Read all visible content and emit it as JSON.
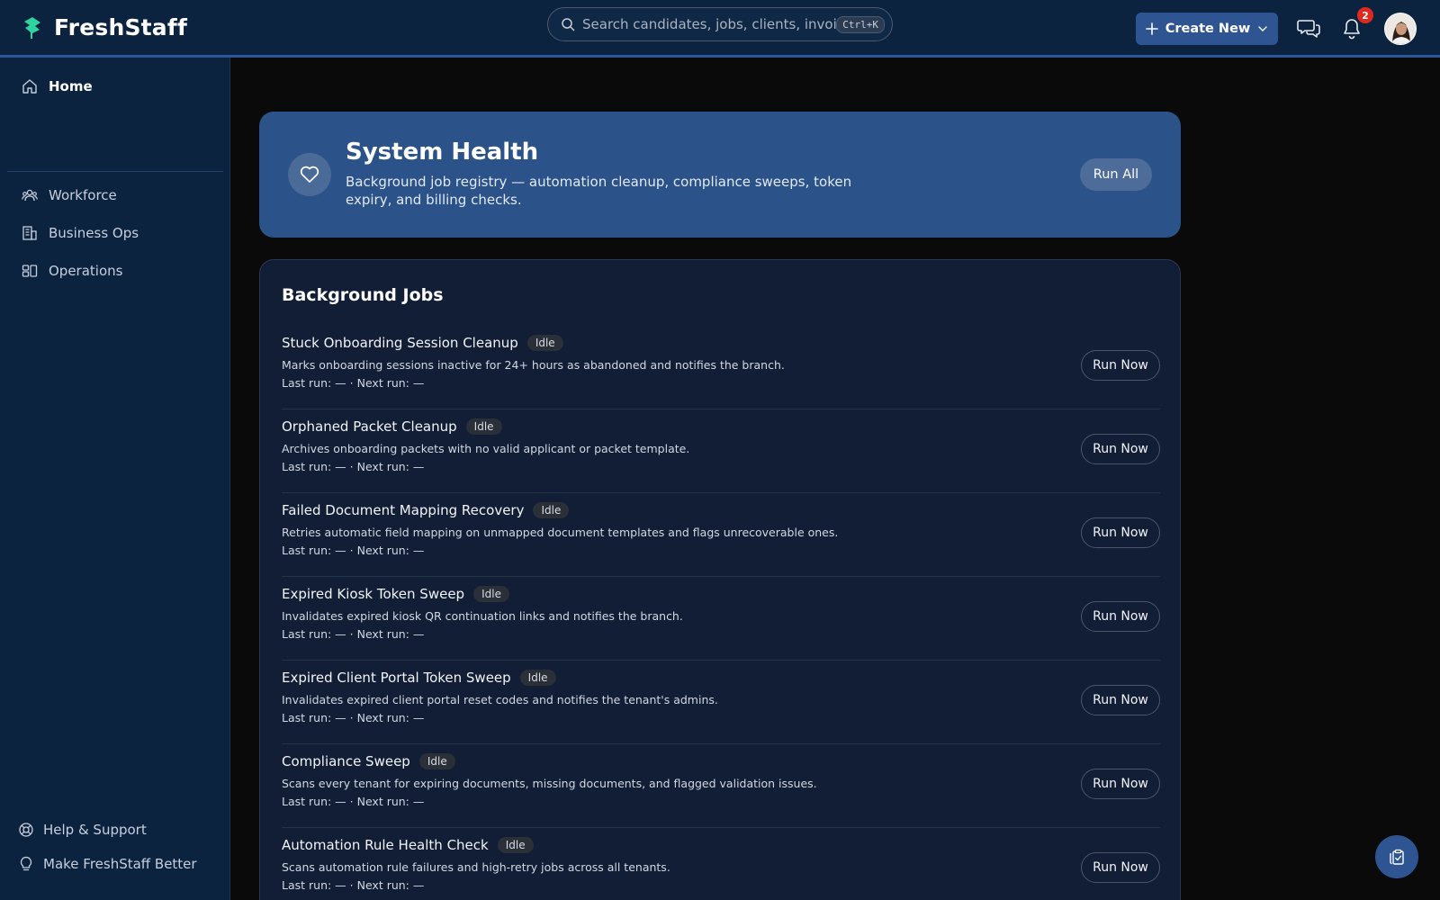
{
  "app": {
    "name": "FreshStaff"
  },
  "header": {
    "search_placeholder": "Search candidates, jobs, clients, invoices...",
    "search_shortcut": "Ctrl+K",
    "create_label": "Create New",
    "notification_count": "2"
  },
  "sidebar": {
    "items": [
      {
        "label": "Home",
        "icon": "home-icon",
        "active": true
      },
      {
        "label": "Workforce",
        "icon": "users-icon"
      },
      {
        "label": "Business Ops",
        "icon": "building-icon"
      },
      {
        "label": "Operations",
        "icon": "layout-icon"
      }
    ],
    "footer": [
      {
        "label": "Help & Support",
        "icon": "lifebuoy-icon"
      },
      {
        "label": "Make FreshStaff Better",
        "icon": "lightbulb-icon"
      }
    ]
  },
  "hero": {
    "title": "System Health",
    "description": "Background job registry — automation cleanup, compliance sweeps, token expiry, and billing checks.",
    "run_all_label": "Run All"
  },
  "jobs": {
    "title": "Background Jobs",
    "run_label": "Run Now",
    "items": [
      {
        "name": "Stuck Onboarding Session Cleanup",
        "status": "Idle",
        "description": "Marks onboarding sessions inactive for 24+ hours as abandoned and notifies the branch.",
        "meta": "Last run: — · Next run: —"
      },
      {
        "name": "Orphaned Packet Cleanup",
        "status": "Idle",
        "description": "Archives onboarding packets with no valid applicant or packet template.",
        "meta": "Last run: — · Next run: —"
      },
      {
        "name": "Failed Document Mapping Recovery",
        "status": "Idle",
        "description": "Retries automatic field mapping on unmapped document templates and flags unrecoverable ones.",
        "meta": "Last run: — · Next run: —"
      },
      {
        "name": "Expired Kiosk Token Sweep",
        "status": "Idle",
        "description": "Invalidates expired kiosk QR continuation links and notifies the branch.",
        "meta": "Last run: — · Next run: —"
      },
      {
        "name": "Expired Client Portal Token Sweep",
        "status": "Idle",
        "description": "Invalidates expired client portal reset codes and notifies the tenant's admins.",
        "meta": "Last run: — · Next run: —"
      },
      {
        "name": "Compliance Sweep",
        "status": "Idle",
        "description": "Scans every tenant for expiring documents, missing documents, and flagged validation issues.",
        "meta": "Last run: — · Next run: —"
      },
      {
        "name": "Automation Rule Health Check",
        "status": "Idle",
        "description": "Scans automation rule failures and high-retry jobs across all tenants.",
        "meta": "Last run: — · Next run: —"
      }
    ]
  },
  "colors": {
    "topbar": "#0c2340",
    "accent": "#2e5591",
    "hero": "#2b5389",
    "card": "#121e35",
    "brand_mark": "#2fd3a0"
  }
}
